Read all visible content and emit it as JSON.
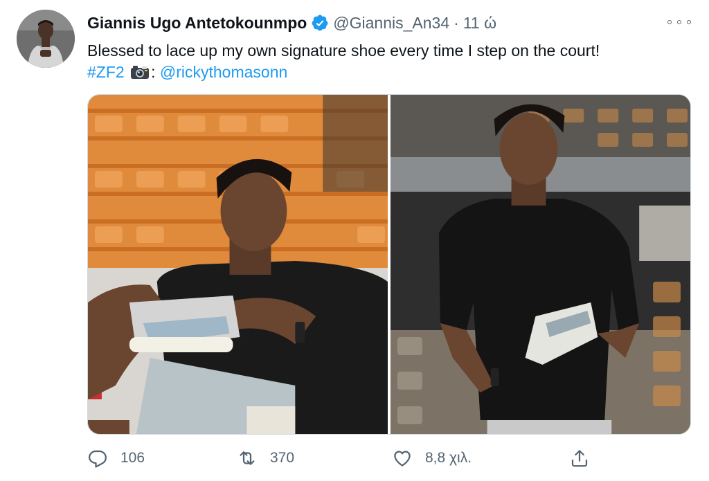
{
  "tweet": {
    "display_name": "Giannis Ugo Antetokounmpo",
    "handle": "@Giannis_An34",
    "separator": "·",
    "time": "11 ώ",
    "text_line1": "Blessed to lace up my own signature shoe every time I step on the court!",
    "hashtag": "#ZF2",
    "camera_icon": "camera-emoji-icon",
    "colon": ":",
    "mention": "@rickythomasonn",
    "accent_color": "#1d9bf0",
    "verified": true
  },
  "media": {
    "photos": [
      {
        "subject": "seated-player-holding-shoe"
      },
      {
        "subject": "standing-player-holding-shoe"
      }
    ]
  },
  "actions": {
    "reply": {
      "icon": "reply-icon",
      "count": "106"
    },
    "retweet": {
      "icon": "retweet-icon",
      "count": "370"
    },
    "like": {
      "icon": "heart-icon",
      "count": "8,8 χιλ."
    },
    "share": {
      "icon": "share-icon"
    }
  }
}
